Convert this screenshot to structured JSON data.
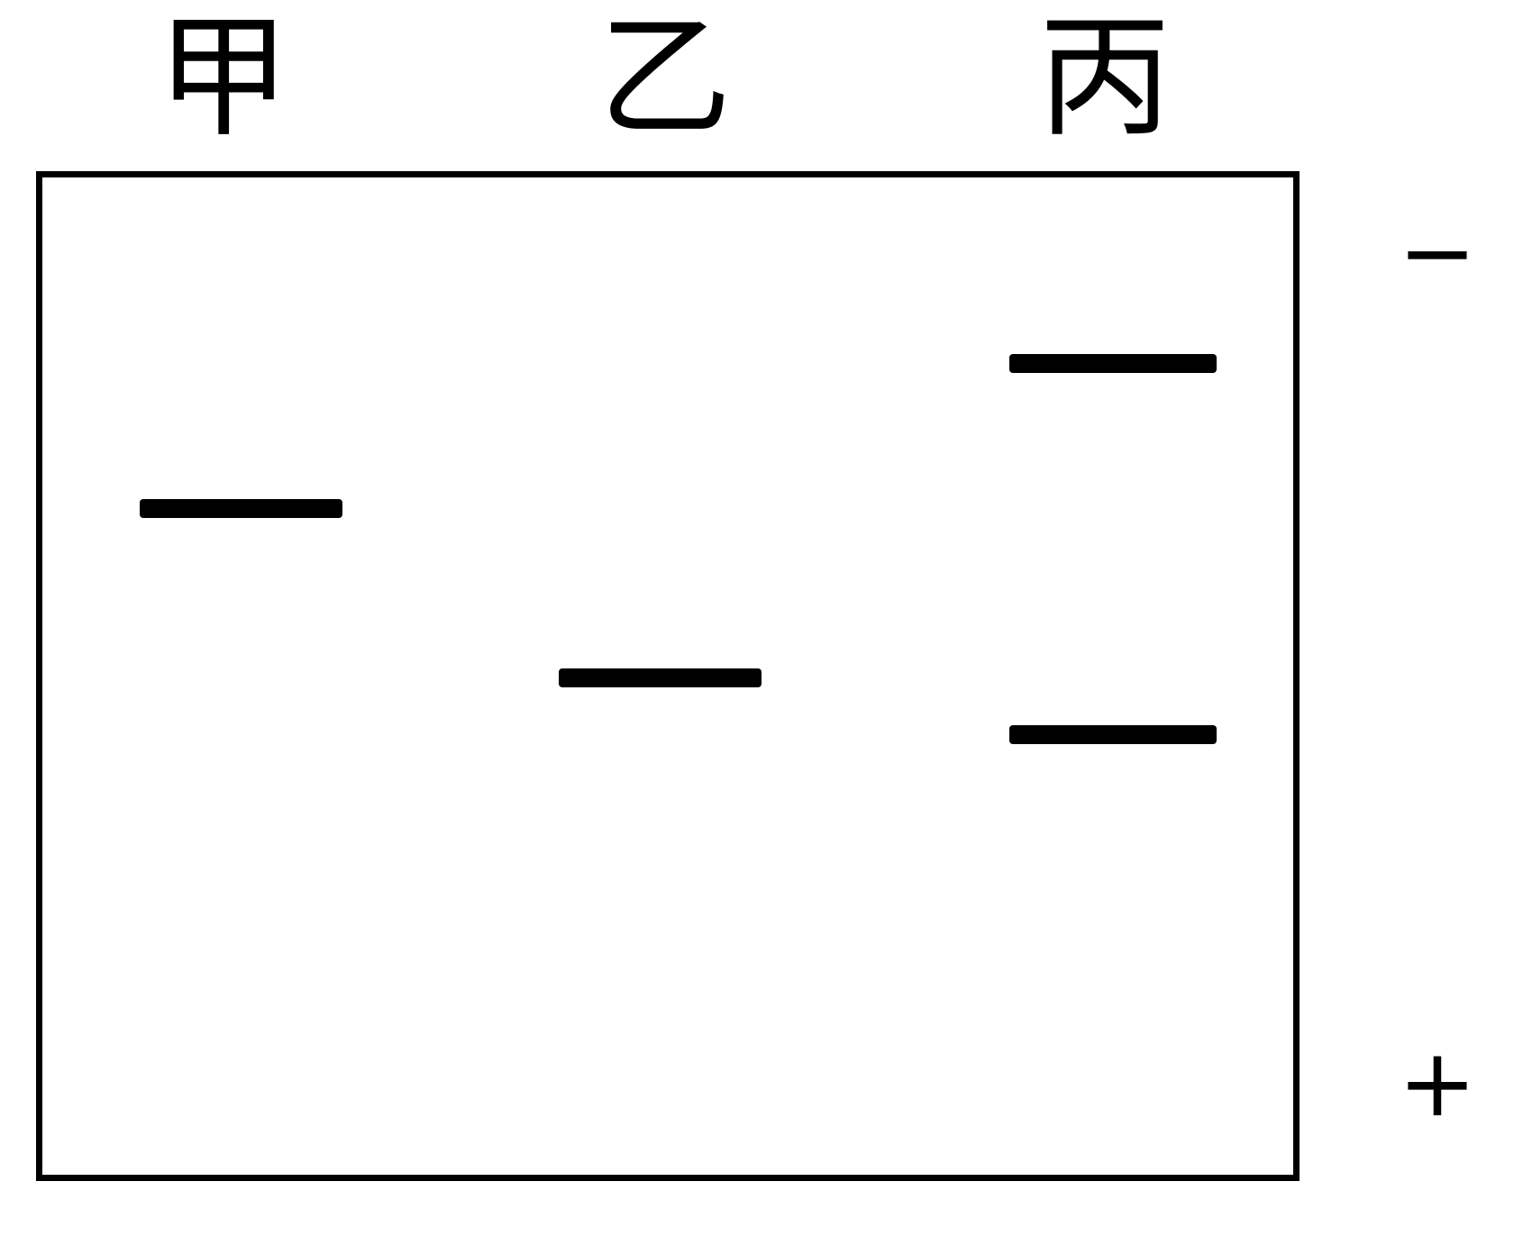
{
  "lanes": [
    {
      "label": "甲"
    },
    {
      "label": "乙"
    },
    {
      "label": "丙"
    }
  ],
  "electrodes": {
    "negative": "−",
    "positive": "+"
  },
  "colors": {
    "band": "#000000",
    "border": "#000000",
    "background": "#ffffff"
  }
}
